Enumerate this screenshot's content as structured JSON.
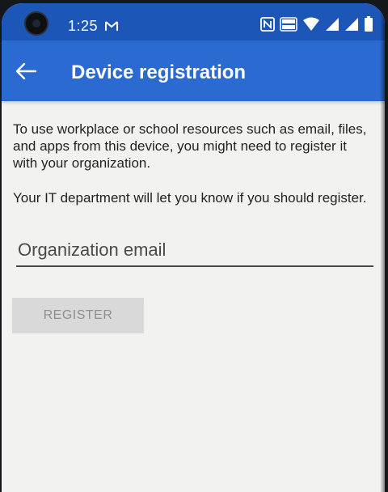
{
  "status_bar": {
    "time": "1:25",
    "icons": [
      "gmail-icon",
      "nfc-icon",
      "volte-icon",
      "wifi-icon",
      "signal-icon",
      "signal-icon-2",
      "battery-icon"
    ]
  },
  "app_bar": {
    "title": "Device registration",
    "back_icon": "arrow-left-icon"
  },
  "content": {
    "paragraph_1": "To use workplace or school resources such as email, files, and apps from this device, you might need to register it with your organization.",
    "paragraph_2": "Your IT department will let you know if you should register."
  },
  "form": {
    "email_placeholder": "Organization email",
    "email_value": "",
    "register_label": "REGISTER",
    "register_enabled": false
  },
  "colors": {
    "status_bar": "#1c57b8",
    "app_bar": "#2b6ad1",
    "background": "#f2f2f0",
    "button_disabled_bg": "#d9d9d9",
    "button_disabled_text": "#8f8f8f"
  }
}
